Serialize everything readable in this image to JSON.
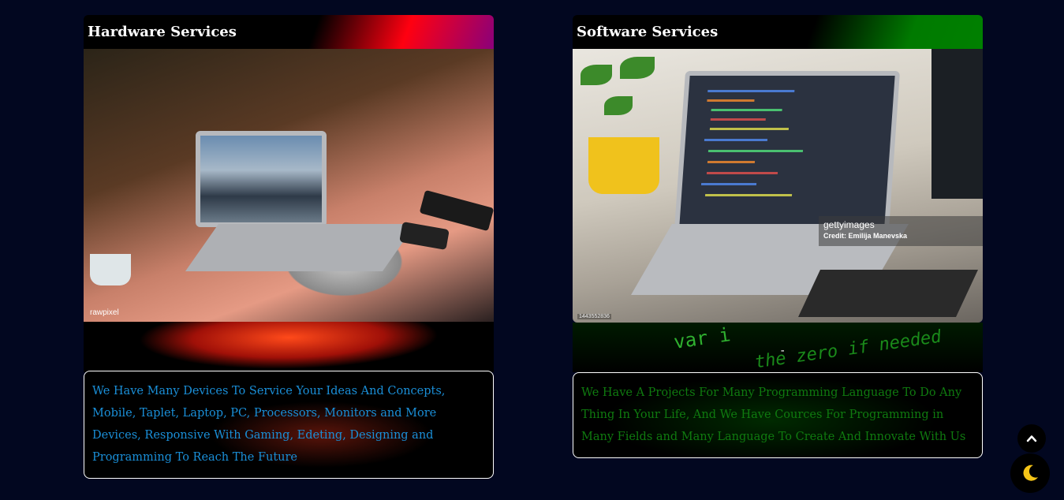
{
  "cards": [
    {
      "title": "Hardware Services",
      "photo_credit": "rawpixel",
      "description": "We Have Many Devices To Service Your Ideas And Concepts, Mobile, Taplet, Laptop, PC, Processors, Monitors and More Devices, Responsive With Gaming, Edeting, Designing and Programming To Reach The Future"
    },
    {
      "title": "Software Services",
      "watermark_brand": "gettyimages",
      "watermark_credit": "Credit: Emilija Manevska",
      "stock_id": "1443552836",
      "strip_text_1": "var i",
      "strip_text_2": "the zero if needed",
      "strip_dash": "-",
      "description": "We Have A Projects For Many Programming Language To Do Any Thing In Your Life, And We Have Cources For Programming in Many Fields and Many Language To Create And Innovate With Us"
    }
  ],
  "fabs": {
    "scroll_top_icon": "chevron-up-icon",
    "theme_icon": "moon-icon"
  },
  "colors": {
    "background": "#020720",
    "hardware_text": "#1a8fd8",
    "software_text": "#0f7a0f",
    "moon": "#f5c518"
  }
}
